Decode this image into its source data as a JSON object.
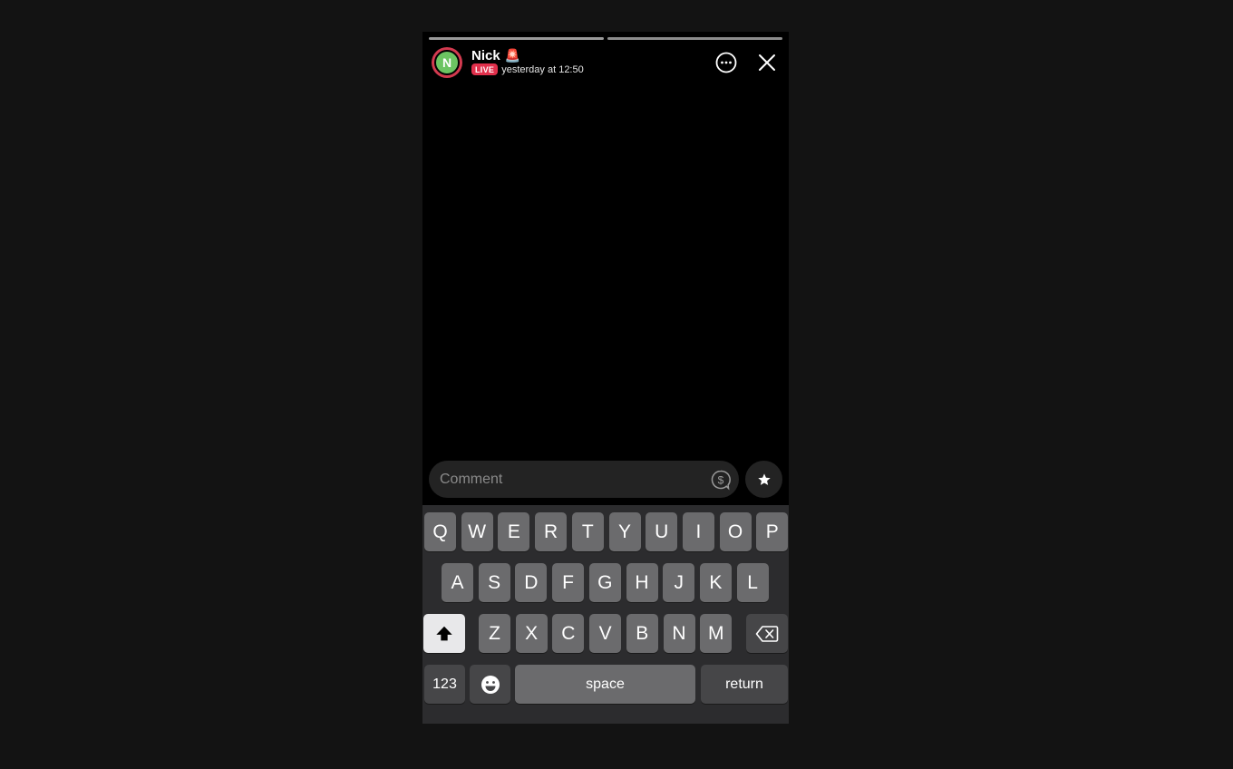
{
  "story": {
    "username": "Nick",
    "username_emoji": "🚨",
    "avatar_initial": "N",
    "live_label": "LIVE",
    "timestamp": "yesterday at 12:50",
    "progress_segments": 2
  },
  "comment": {
    "placeholder": "Comment",
    "value": ""
  },
  "keyboard": {
    "row1": [
      "Q",
      "W",
      "E",
      "R",
      "T",
      "Y",
      "U",
      "I",
      "O",
      "P"
    ],
    "row2": [
      "A",
      "S",
      "D",
      "F",
      "G",
      "H",
      "J",
      "K",
      "L"
    ],
    "row3": [
      "Z",
      "X",
      "C",
      "V",
      "B",
      "N",
      "M"
    ],
    "numbers_label": "123",
    "space_label": "space",
    "return_label": "return"
  },
  "icons": {
    "more": "more-options-icon",
    "close": "close-icon",
    "dollar": "dollar-icon",
    "star": "star-icon",
    "shift": "shift-icon",
    "backspace": "backspace-icon",
    "emoji": "emoji-icon"
  },
  "colors": {
    "live": "#e1304c",
    "avatar": "#6cc462",
    "ring": "#d23a4f"
  }
}
